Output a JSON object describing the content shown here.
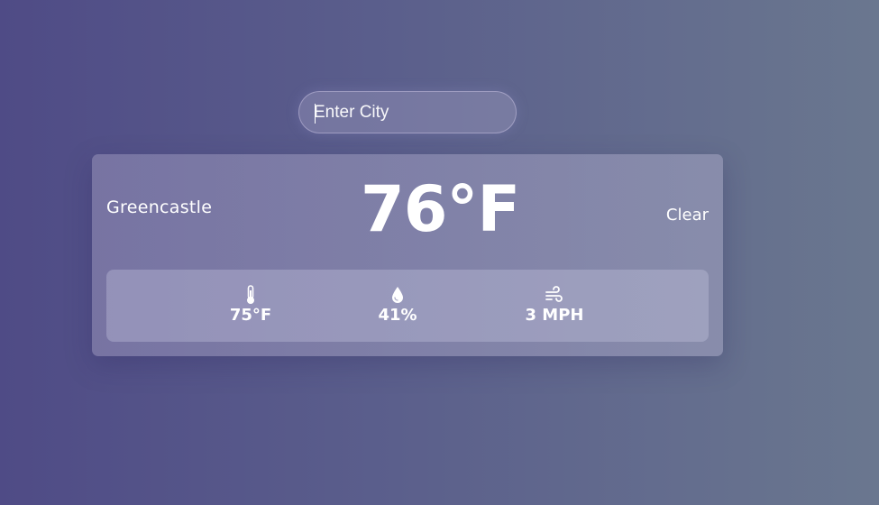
{
  "search": {
    "placeholder": "Enter City",
    "value": ""
  },
  "weather": {
    "city": "Greencastle",
    "temperature": "76°F",
    "clear_label": "Clear",
    "details": {
      "feels_like": "75°F",
      "humidity": "41%",
      "wind": "3 MPH"
    }
  },
  "icons": {
    "feels_like": "thermometer-icon",
    "humidity": "droplet-icon",
    "wind": "wind-icon"
  },
  "colors": {
    "text": "#ffffff",
    "background_start": "#4f4b86",
    "background_end": "#6a778f"
  }
}
